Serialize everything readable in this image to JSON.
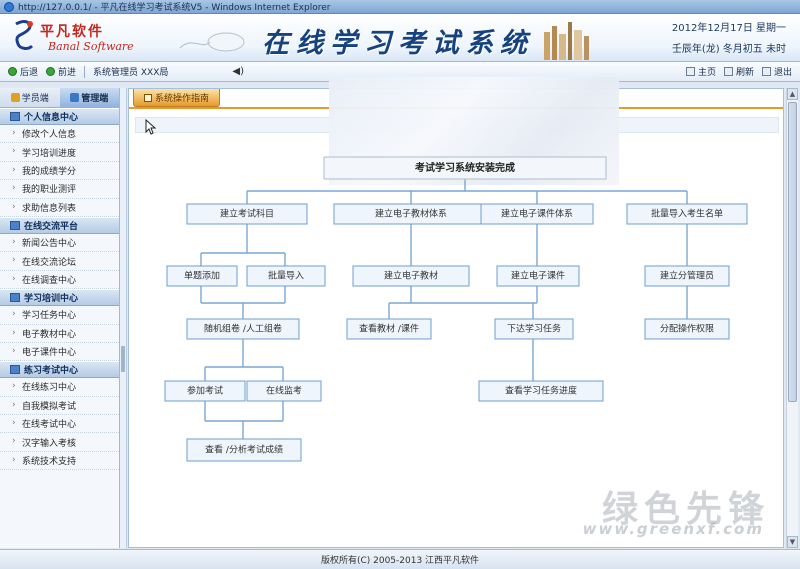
{
  "window": {
    "title": "http://127.0.0.1/ - 平凡在线学习考试系统V5 - Windows Internet Explorer"
  },
  "banner": {
    "logo_cn": "平凡软件",
    "logo_en": "Banal Software",
    "system_title": "在线学习考试系统",
    "date_line1": "2012年12月17日 星期一",
    "date_line2": "壬辰年(龙) 冬月初五 未时"
  },
  "toolbar": {
    "back": "后退",
    "forward": "前进",
    "admin": "系统管理员 XXX局",
    "speaker": "◀)",
    "home": "主页",
    "refresh": "刷新",
    "logout": "退出"
  },
  "sidebar": {
    "tabs": [
      {
        "label": "学员端"
      },
      {
        "label": "管理端"
      }
    ],
    "groups": [
      {
        "title": "个人信息中心",
        "items": [
          "修改个人信息",
          "学习培训进度",
          "我的成绩学分",
          "我的职业测评",
          "求助信息列表"
        ]
      },
      {
        "title": "在线交流平台",
        "items": [
          "新闻公告中心",
          "在线交流论坛",
          "在线调查中心"
        ]
      },
      {
        "title": "学习培训中心",
        "items": [
          "学习任务中心",
          "电子教材中心",
          "电子课件中心"
        ]
      },
      {
        "title": "练习考试中心",
        "items": [
          "在线练习中心",
          "自我模拟考试",
          "在线考试中心",
          "汉字输入考核",
          "系统技术支持"
        ]
      }
    ]
  },
  "main": {
    "tab_label": "系统操作指南",
    "flow": {
      "top": "考试学习系统安装完成",
      "n_subject": "建立考试科目",
      "n_material_sys": "建立电子教材体系",
      "n_course_sys": "建立电子课件体系",
      "n_import": "批量导入考生名单",
      "n_single": "单题添加",
      "n_batch": "批量导入",
      "n_material": "建立电子教材",
      "n_course": "建立电子课件",
      "n_submgr": "建立分管理员",
      "n_paper": "随机组卷 /人工组卷",
      "n_view": "查看教材 /课件",
      "n_task": "下达学习任务",
      "n_perm": "分配操作权限",
      "n_exam": "参加考试",
      "n_monitor": "在线监考",
      "n_progress": "查看学习任务进度",
      "n_analysis": "查看 /分析考试成绩"
    }
  },
  "footer": {
    "copyright": "版权所有(C) 2005-2013 江西平凡软件"
  },
  "watermark": {
    "cn": "绿色先锋",
    "en": "www.greenxf.com"
  }
}
